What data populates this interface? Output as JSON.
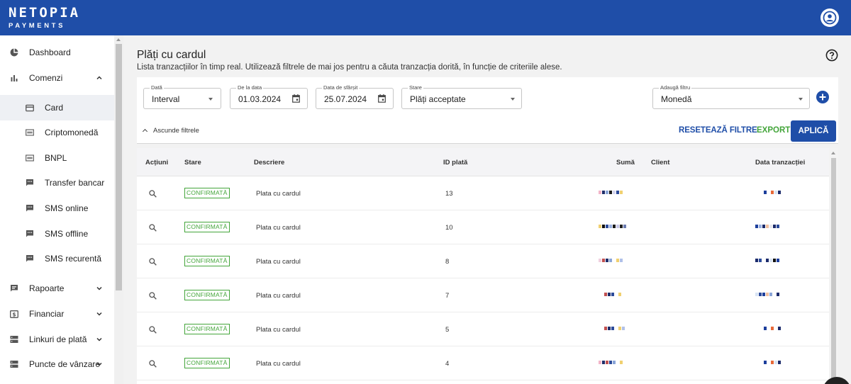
{
  "brand": {
    "line1": "NETOPIA",
    "line2": "PAYMENTS"
  },
  "sidebar": {
    "items": [
      {
        "label": "Dashboard",
        "icon": "pie-chart-icon"
      },
      {
        "label": "Comenzi",
        "icon": "bar-chart-icon",
        "expanded": true
      },
      {
        "label": "Card",
        "icon": "credit-card-icon",
        "active": true
      },
      {
        "label": "Criptomonedă",
        "icon": "crypto-icon"
      },
      {
        "label": "BNPL",
        "icon": "bnpl-icon"
      },
      {
        "label": "Transfer bancar",
        "icon": "message-icon"
      },
      {
        "label": "SMS online",
        "icon": "message-icon"
      },
      {
        "label": "SMS offline",
        "icon": "message-icon"
      },
      {
        "label": "SMS recurentă",
        "icon": "message-icon"
      },
      {
        "label": "Rapoarte",
        "icon": "report-icon",
        "expanded": false
      },
      {
        "label": "Financiar",
        "icon": "money-icon",
        "expanded": false
      },
      {
        "label": "Linkuri de plată",
        "icon": "link-icon",
        "expanded": false
      },
      {
        "label": "Puncte de vânzare",
        "icon": "pos-icon",
        "expanded": false
      }
    ]
  },
  "page": {
    "title": "Plăți cu cardul",
    "subtitle": "Lista tranzacțiilor în timp real. Utilizează filtrele de mai jos pentru a căuta tranzacția dorită, în funcție de criteriile alese."
  },
  "filters": {
    "date": {
      "label": "Dată",
      "value": "Interval"
    },
    "from": {
      "label": "De la data",
      "value": "01.03.2024"
    },
    "to": {
      "label": "Data de sfârșit",
      "value": "25.07.2024"
    },
    "status": {
      "label": "Stare",
      "value": "Plăți acceptate"
    },
    "add_filter": {
      "label": "Adaugă filtru",
      "value": "Monedă"
    },
    "toggle_label": "Ascunde filtrele",
    "reset_label": "RESETEAZĂ FILTRE",
    "export_label": "EXPORT",
    "apply_label": "APLICĂ"
  },
  "table": {
    "columns": {
      "actions": "Acțiuni",
      "status": "Stare",
      "description": "Descriere",
      "payment_id": "ID plată",
      "amount": "Sumă",
      "client": "Client",
      "date": "Data tranzacției"
    },
    "rows": [
      {
        "status": "CONFIRMATĂ",
        "description": "Plata cu cardul",
        "payment_id": "13"
      },
      {
        "status": "CONFIRMATĂ",
        "description": "Plata cu cardul",
        "payment_id": "10"
      },
      {
        "status": "CONFIRMATĂ",
        "description": "Plata cu cardul",
        "payment_id": "8"
      },
      {
        "status": "CONFIRMATĂ",
        "description": "Plata cu cardul",
        "payment_id": "7"
      },
      {
        "status": "CONFIRMATĂ",
        "description": "Plata cu cardul",
        "payment_id": "5"
      },
      {
        "status": "CONFIRMATĂ",
        "description": "Plata cu cardul",
        "payment_id": "4"
      }
    ]
  },
  "colors": {
    "brand_blue": "#1f4ea8",
    "confirm_green": "#43a53a"
  }
}
